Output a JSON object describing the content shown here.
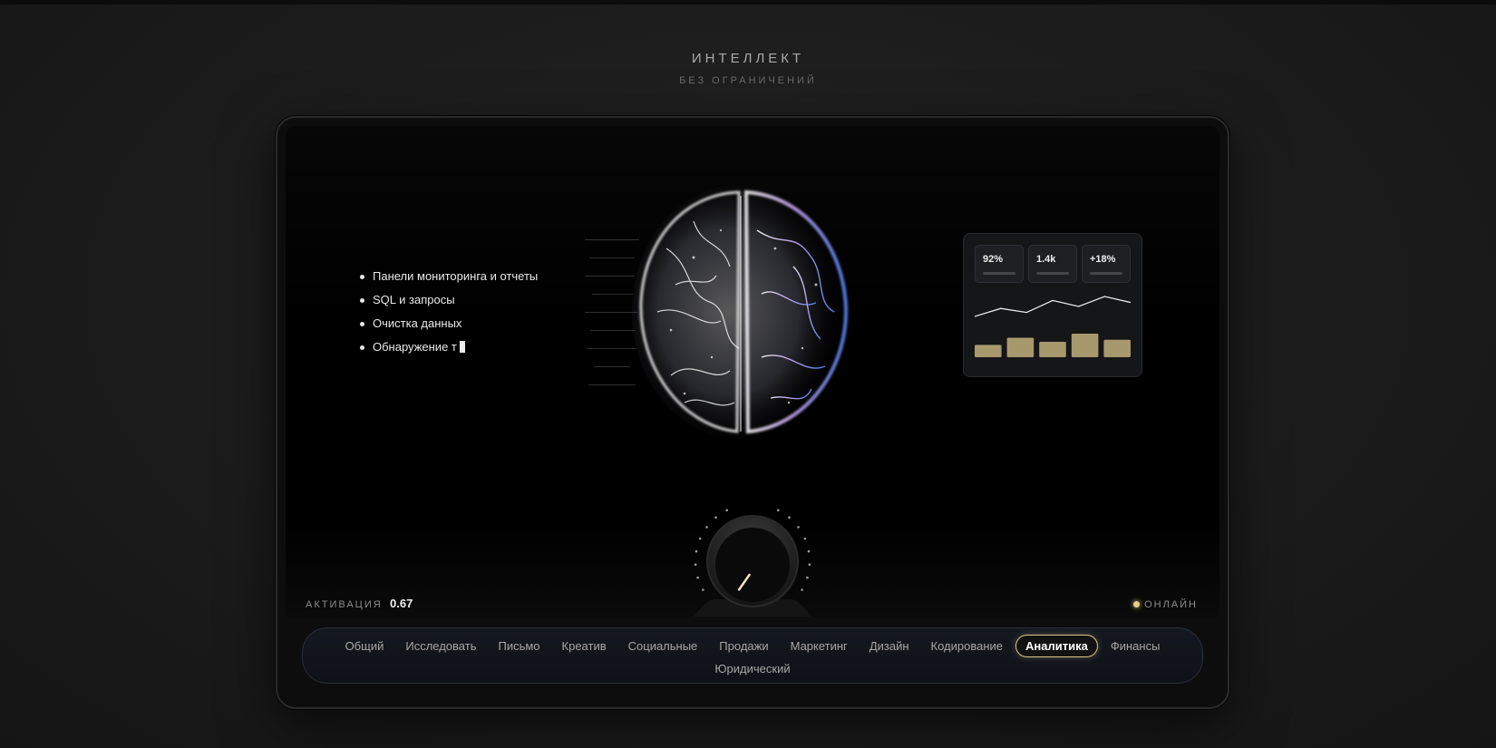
{
  "hero": {
    "title": "ИНТЕЛЛЕКТ",
    "subtitle": "БЕЗ ОГРАНИЧЕНИЙ"
  },
  "capabilities": [
    "Панели мониторинга и отчеты",
    "SQL и запросы",
    "Очистка данных",
    "Обнаружение т"
  ],
  "stats": {
    "cards": [
      "92%",
      "1.4k",
      "+18%"
    ],
    "sparkline": [
      4,
      12,
      8,
      20,
      14,
      24,
      18
    ],
    "bars": [
      12,
      19,
      15,
      23,
      17
    ]
  },
  "activation": {
    "label": "АКТИВАЦИЯ",
    "value": "0.67",
    "level": 0.67
  },
  "status": {
    "label": "ОНЛАЙН",
    "color": "#e7cf8b"
  },
  "tabs": {
    "row1": [
      "Общий",
      "Исследовать",
      "Письмо",
      "Креатив",
      "Социальные",
      "Продажи",
      "Маркетинг",
      "Дизайн",
      "Кодирование",
      "Аналитика",
      "Финансы"
    ],
    "row2": [
      "Юридический"
    ],
    "active": "Аналитика"
  },
  "colors": {
    "accent": "#d8c38d",
    "bar": "#a8986d",
    "background": "#1b1b1b"
  },
  "icons": {
    "status": "status-dot-icon",
    "knob": "activation-knob-icon",
    "brain": "brain-visual"
  }
}
